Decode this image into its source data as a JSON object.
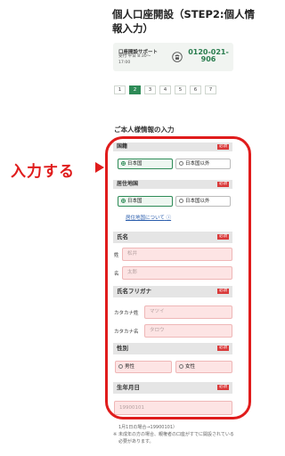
{
  "header": {
    "title": "個人口座開設（STEP2:個人情報入力）"
  },
  "support": {
    "label": "口座開設サポート",
    "hours": "受付 平日 8:30〜 17:00",
    "phone": "0120-021-906"
  },
  "steps": [
    {
      "num": "1"
    },
    {
      "num": "2"
    },
    {
      "num": "3"
    },
    {
      "num": "4"
    },
    {
      "num": "5"
    },
    {
      "num": "6"
    },
    {
      "num": "7"
    }
  ],
  "section_title": "ご本人様情報の入力",
  "annotation": "入力する",
  "required_badge": "必須",
  "fields": {
    "nationality": {
      "label": "国籍",
      "options": [
        "日本国",
        "日本国以外"
      ]
    },
    "residence": {
      "label": "居住地国",
      "options": [
        "日本国",
        "日本国以外"
      ],
      "link": "居住地国について"
    },
    "name": {
      "label": "氏名",
      "sei_label": "姓",
      "sei_placeholder": "松井",
      "mei_label": "名",
      "mei_placeholder": "太郎"
    },
    "kana": {
      "label": "氏名フリガナ",
      "sei_label": "カタカナ姓",
      "sei_placeholder": "マツイ",
      "mei_label": "カタカナ名",
      "mei_placeholder": "タロウ"
    },
    "gender": {
      "label": "性別",
      "options": [
        "男性",
        "女性"
      ]
    },
    "birthdate": {
      "label": "生年月日",
      "placeholder": "19900101"
    }
  },
  "notes": [
    "1月1日の場合→19900101）",
    "未成年の方の場合、親権者の口座がすでに開設されている必要があります。"
  ]
}
